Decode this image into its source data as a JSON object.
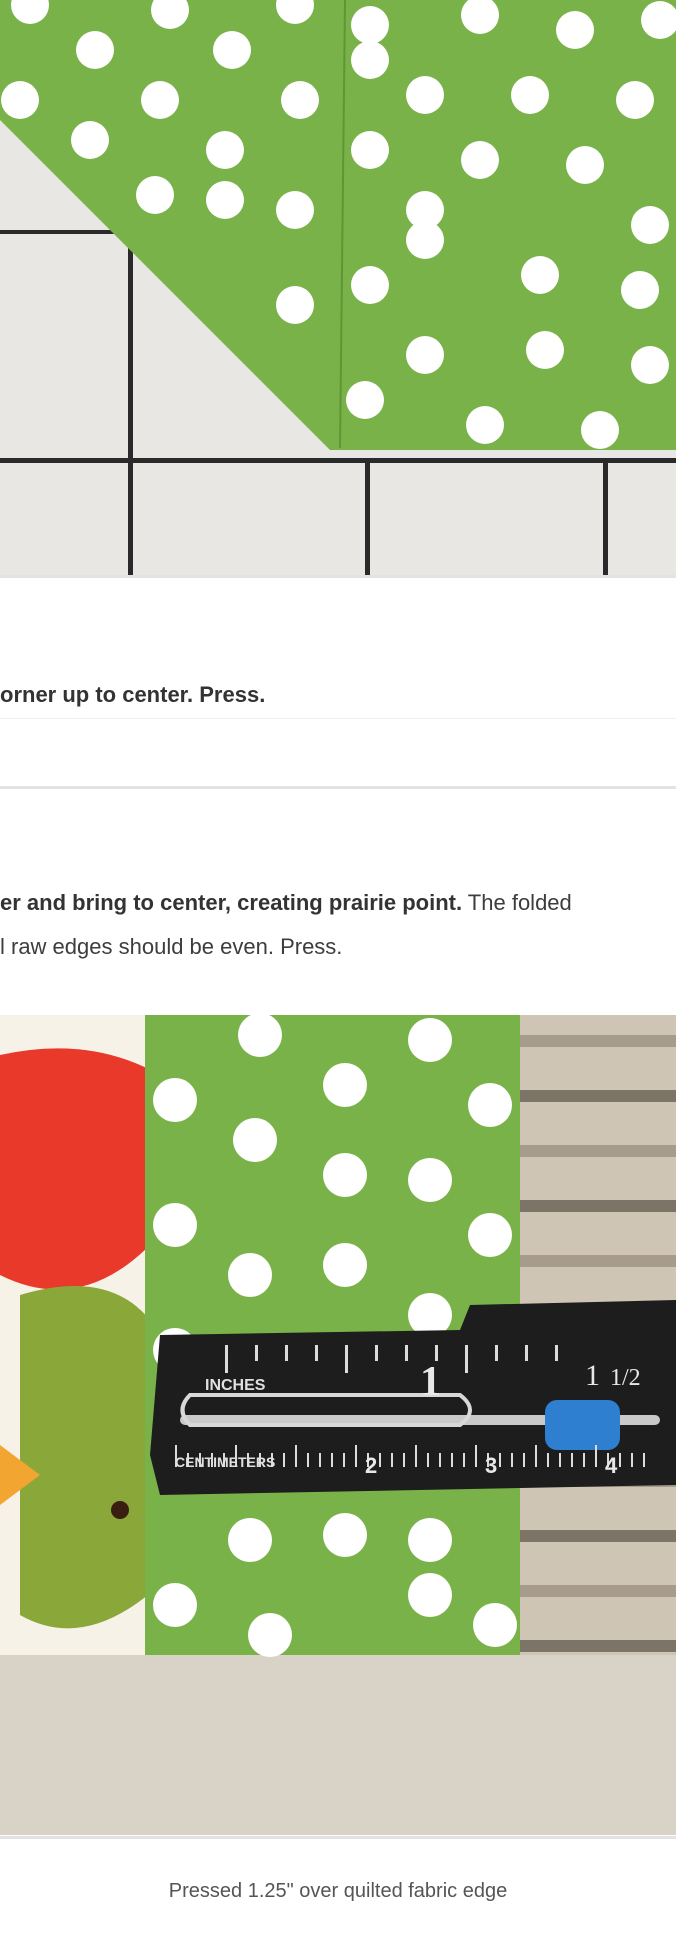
{
  "steps": {
    "step_fold_corner": {
      "bold": "orner up to center. Press.",
      "rest": ""
    },
    "step_prairie_point": {
      "bold": "er and bring to center, creating prairie point.",
      "rest": " The folded",
      "line2": "l raw edges should be even. Press."
    }
  },
  "ruler": {
    "inches_label": "INCHES",
    "centimeters_label": "CENTIMETERS",
    "mark_1": "1",
    "mark_1_5": "1",
    "mark_half": "1/2",
    "cm_2": "2",
    "cm_3": "3",
    "cm_4": "4"
  },
  "caption": "Pressed 1.25\" over quilted fabric edge",
  "colors": {
    "fabric_green": "#7ab24a",
    "dot_white": "#ffffff",
    "mat_grey": "#e9e7e4",
    "mat_line": "#2a2a2a",
    "bird_red": "#e8392b",
    "gauge_blue": "#2f7fd1"
  }
}
